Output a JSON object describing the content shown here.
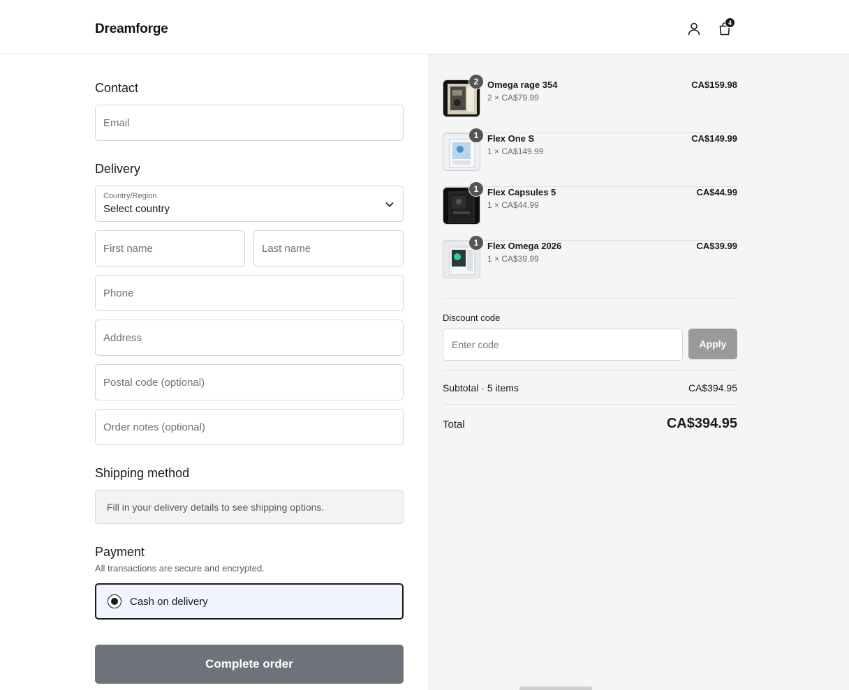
{
  "header": {
    "brand": "Dreamforge",
    "cart_count": "4"
  },
  "contact": {
    "title": "Contact",
    "email_placeholder": "Email"
  },
  "delivery": {
    "title": "Delivery",
    "country_label": "Country/Region",
    "country_value": "Select country",
    "first_name_placeholder": "First name",
    "last_name_placeholder": "Last name",
    "phone_placeholder": "Phone",
    "address_placeholder": "Address",
    "postal_placeholder": "Postal code (optional)",
    "notes_placeholder": "Order notes (optional)"
  },
  "shipping": {
    "title": "Shipping method",
    "message": "Fill in your delivery details to see shipping options."
  },
  "payment": {
    "title": "Payment",
    "subtitle": "All transactions are secure and encrypted.",
    "option_label": "Cash on delivery",
    "selected": true
  },
  "complete_label": "Complete order",
  "items": [
    {
      "name": "Omega rage 354",
      "qty": "2",
      "unit": "2 × CA$79.99",
      "price": "CA$159.98"
    },
    {
      "name": "Flex One S",
      "qty": "1",
      "unit": "1 × CA$149.99",
      "price": "CA$149.99"
    },
    {
      "name": "Flex Capsules 5",
      "qty": "1",
      "unit": "1 × CA$44.99",
      "price": "CA$44.99"
    },
    {
      "name": "Flex Omega 2026",
      "qty": "1",
      "unit": "1 × CA$39.99",
      "price": "CA$39.99"
    }
  ],
  "discount": {
    "label": "Discount code",
    "placeholder": "Enter code",
    "apply_label": "Apply"
  },
  "summary": {
    "subtotal_label": "Subtotal · 5 items",
    "subtotal_value": "CA$394.95",
    "total_label": "Total",
    "total_value": "CA$394.95"
  },
  "icons": {
    "account": "user-icon",
    "cart": "shopping-bag-icon",
    "chevron": "chevron-down-icon"
  },
  "colors": {
    "complete_button": "#6e737b",
    "apply_button": "#9a9a9a",
    "selected_payment_bg": "#eff4fd",
    "summary_panel_bg": "#f5f5f5"
  }
}
